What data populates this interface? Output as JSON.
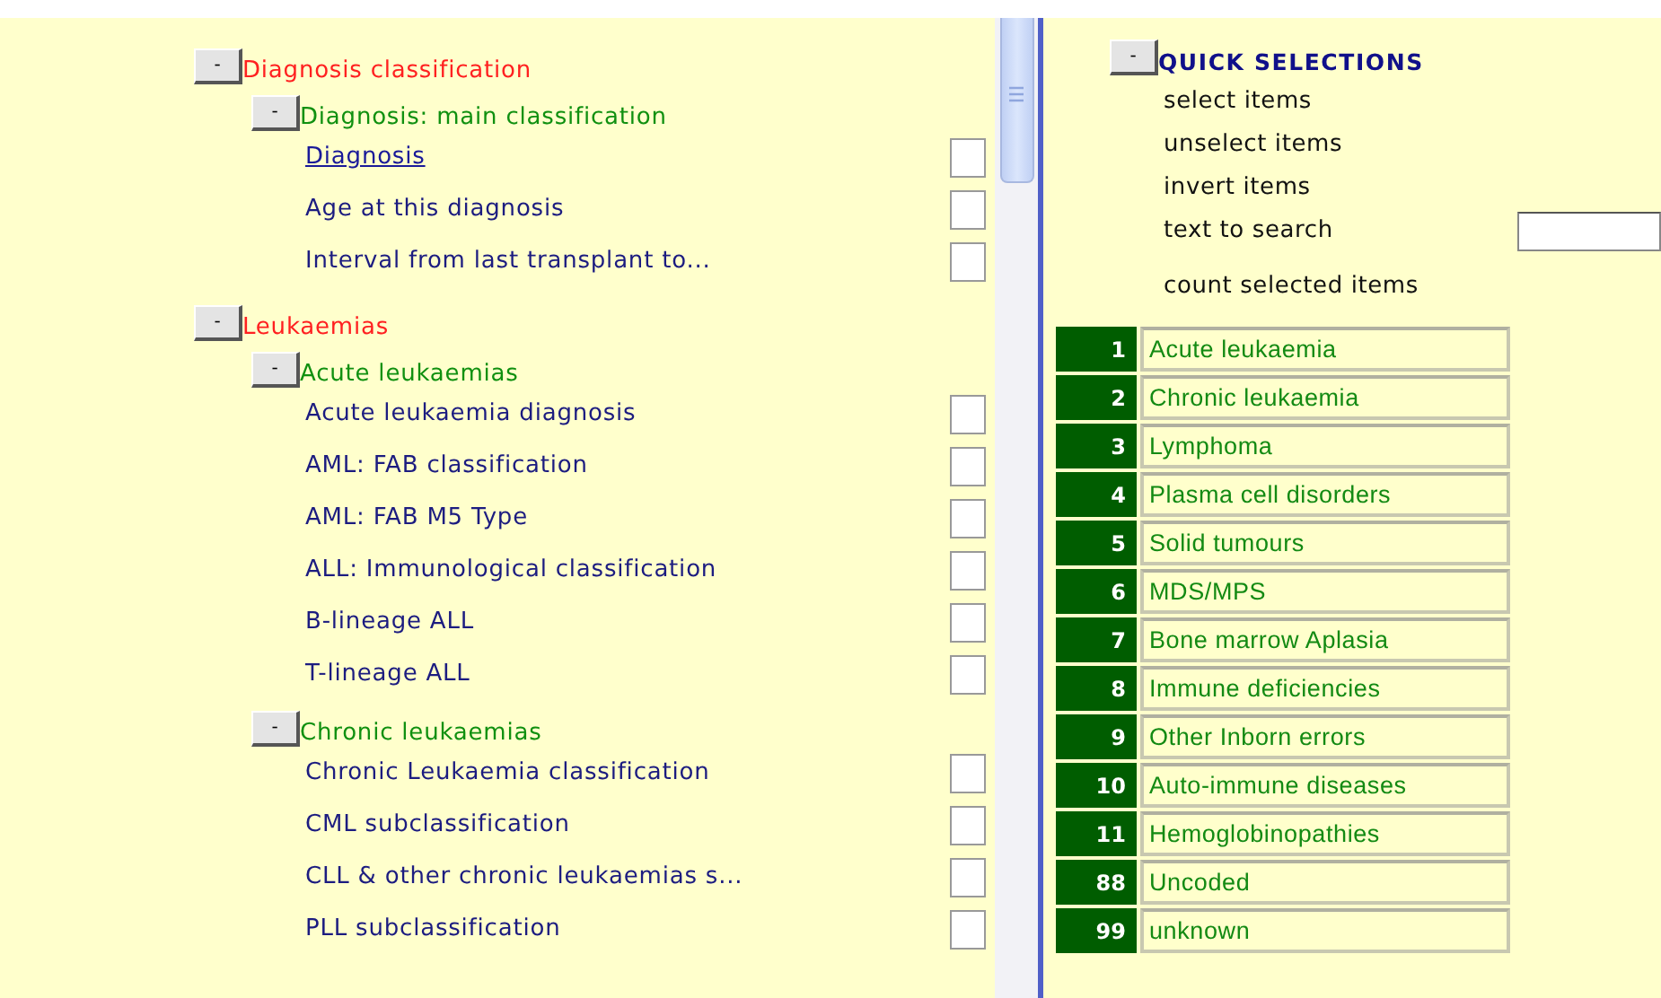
{
  "tree": [
    {
      "label": "Diagnosis classification",
      "kind": "group",
      "toggle": "-",
      "children": [
        {
          "label": "Diagnosis: main classification",
          "kind": "group",
          "toggle": "-",
          "children": [
            {
              "label": "Diagnosis",
              "kind": "item",
              "hovered": true,
              "checked": false
            },
            {
              "label": "Age at this diagnosis",
              "kind": "item",
              "hovered": false,
              "checked": false
            },
            {
              "label": "Interval from last transplant to...",
              "kind": "item",
              "hovered": false,
              "checked": false
            }
          ]
        }
      ]
    },
    {
      "label": "Leukaemias",
      "kind": "group",
      "toggle": "-",
      "children": [
        {
          "label": "Acute leukaemias",
          "kind": "group",
          "toggle": "-",
          "children": [
            {
              "label": "Acute leukaemia diagnosis",
              "kind": "item",
              "hovered": false,
              "checked": false
            },
            {
              "label": "AML: FAB classification",
              "kind": "item",
              "hovered": false,
              "checked": false
            },
            {
              "label": "AML: FAB M5 Type",
              "kind": "item",
              "hovered": false,
              "checked": false
            },
            {
              "label": "ALL: Immunological classification",
              "kind": "item",
              "hovered": false,
              "checked": false
            },
            {
              "label": "B-lineage ALL",
              "kind": "item",
              "hovered": false,
              "checked": false
            },
            {
              "label": "T-lineage ALL",
              "kind": "item",
              "hovered": false,
              "checked": false
            }
          ]
        },
        {
          "label": "Chronic leukaemias",
          "kind": "group",
          "toggle": "-",
          "children": [
            {
              "label": "Chronic Leukaemia classification",
              "kind": "item",
              "hovered": false,
              "checked": false
            },
            {
              "label": "CML subclassification",
              "kind": "item",
              "hovered": false,
              "checked": false
            },
            {
              "label": "CLL & other chronic leukaemias s...",
              "kind": "item",
              "hovered": false,
              "checked": false
            },
            {
              "label": "PLL subclassification",
              "kind": "item",
              "hovered": false,
              "checked": false
            }
          ]
        }
      ]
    }
  ],
  "quick_selections": {
    "toggle": "-",
    "title": "QUICK SELECTIONS",
    "actions": [
      {
        "label": "select items",
        "kind": "link"
      },
      {
        "label": "unselect items",
        "kind": "link"
      },
      {
        "label": "invert items",
        "kind": "link"
      },
      {
        "label": "text to search",
        "kind": "search"
      },
      {
        "label": "count selected items",
        "kind": "link"
      }
    ]
  },
  "categories": [
    {
      "code": "1",
      "label": "Acute leukaemia"
    },
    {
      "code": "2",
      "label": "Chronic leukaemia"
    },
    {
      "code": "3",
      "label": "Lymphoma"
    },
    {
      "code": "4",
      "label": "Plasma cell disorders"
    },
    {
      "code": "5",
      "label": "Solid tumours"
    },
    {
      "code": "6",
      "label": "MDS/MPS"
    },
    {
      "code": "7",
      "label": "Bone marrow Aplasia"
    },
    {
      "code": "8",
      "label": "Immune deficiencies"
    },
    {
      "code": "9",
      "label": "Other Inborn errors"
    },
    {
      "code": "10",
      "label": "Auto-immune diseases"
    },
    {
      "code": "11",
      "label": "Hemoglobinopathies"
    },
    {
      "code": "88",
      "label": "Uncoded"
    },
    {
      "code": "99",
      "label": "unknown"
    }
  ]
}
